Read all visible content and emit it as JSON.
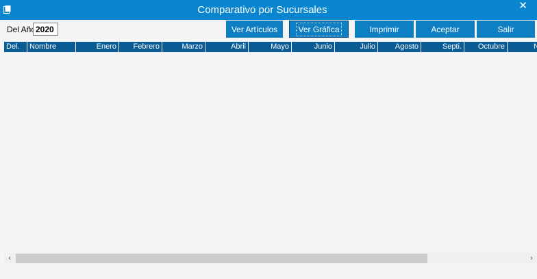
{
  "window": {
    "title": "Comparativo por Sucursales",
    "close_glyph": "✕",
    "icon": "app-window-icon"
  },
  "year": {
    "label": "Del Año",
    "value": "2020"
  },
  "toolbar": {
    "ver_articulos": "Ver Artículos",
    "ver_grafica": "Ver Gráfica",
    "imprimir": "Imprimir",
    "aceptar": "Aceptar",
    "salir": "Salir"
  },
  "table": {
    "columns": [
      "Del.",
      "Nombre",
      "Enero",
      "Febrero",
      "Marzo",
      "Abril",
      "Mayo",
      "Junio",
      "Julio",
      "Agosto",
      "Septi.",
      "Octubre",
      "Novi"
    ]
  },
  "scrollbar": {
    "left_glyph": "‹",
    "right_glyph": "›"
  },
  "colors": {
    "titlebar": "#0a86d1",
    "button": "#0f7fc4",
    "header": "#0a5a94",
    "background": "#f4f4f4"
  }
}
